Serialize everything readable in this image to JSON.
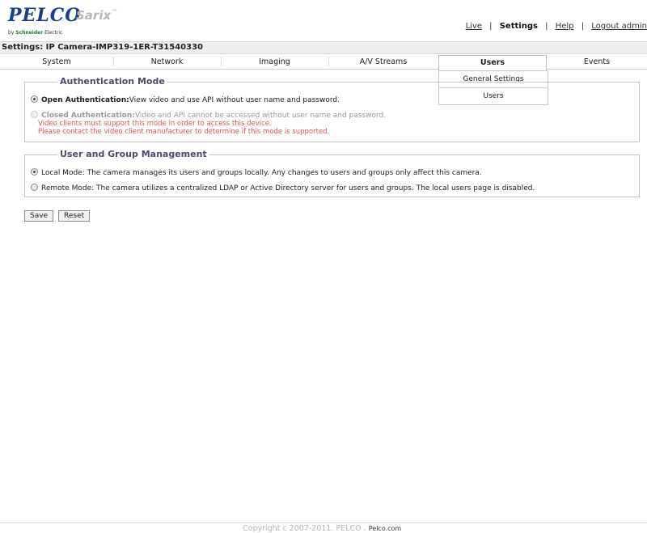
{
  "header": {
    "logo_main": "PELCO",
    "logo_product": "Sarix",
    "logo_tm": "™",
    "logo_by_prefix": "by",
    "logo_by_company": "Schneider",
    "logo_by_suffix": "Electric",
    "nav": {
      "live": "Live",
      "settings": "Settings",
      "help": "Help",
      "logout": "Logout admin",
      "separator": "|"
    }
  },
  "title": "Settings: IP Camera-IMP319-1ER-T31540330",
  "tabs": [
    "System",
    "Network",
    "Imaging",
    "A/V Streams",
    "Users",
    "Events"
  ],
  "active_tab": "Users",
  "dropdown": [
    "General Settings",
    "Users"
  ],
  "auth": {
    "legend": "Authentication Mode",
    "open_label": "Open Authentication:",
    "open_desc": "View video and use API without user name and password.",
    "closed_label": "Closed Authentication:",
    "closed_desc": "Video and API cannot be accessed without user name and password.",
    "warning_1": "Video clients must support this mode in order to access this device.",
    "warning_2": "Please contact the video client manufacturer to determine if this mode is supported.",
    "selected": "open"
  },
  "user_mgmt": {
    "legend": "User and Group Management",
    "local": "Local Mode: The camera manages its users and groups locally. Any changes to users and groups only affect this camera.",
    "remote": "Remote Mode: The camera utilizes a centralized LDAP or Active Directory server for users and groups. The local users page is disabled.",
    "selected": "local"
  },
  "buttons": {
    "save": "Save",
    "reset": "Reset"
  },
  "footer": {
    "copyright": "Copyright c 2007-2011. PELCO",
    "separator": ".",
    "link": "Pelco.com"
  },
  "colors": {
    "brand": "#1a3e8c",
    "legend": "#4b4b6e",
    "warning": "#e35050",
    "disabled": "#9a9a9a"
  }
}
